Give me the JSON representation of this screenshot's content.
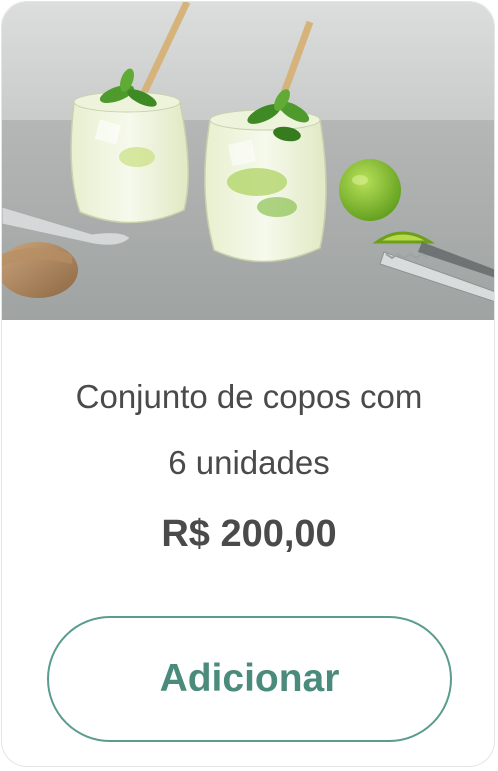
{
  "product": {
    "image_alt": "mojito-glasses-photo",
    "title_line1": "Conjunto de copos com",
    "title_line2": "6 unidades",
    "price": "R$ 200,00",
    "add_button_label": "Adicionar"
  },
  "colors": {
    "accent": "#4b8b7c",
    "accent_border": "#5a9c8d",
    "text": "#4a4a4a",
    "card_border": "#e3e6e5"
  }
}
